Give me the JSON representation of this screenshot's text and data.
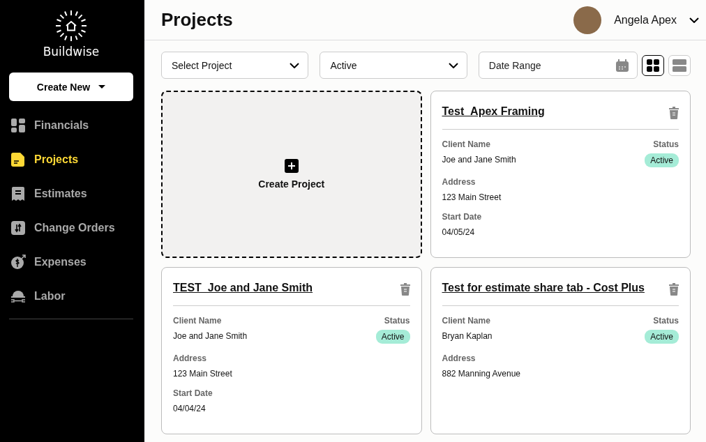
{
  "sidebar": {
    "brand": "Buildwise",
    "create_button": "Create New",
    "items": [
      {
        "label": "Financials",
        "kind": "grid",
        "selected": false
      },
      {
        "label": "Projects",
        "kind": "document",
        "selected": true
      },
      {
        "label": "Estimates",
        "kind": "receipt",
        "selected": false
      },
      {
        "label": "Change Orders",
        "kind": "swap",
        "selected": false
      },
      {
        "label": "Expenses",
        "kind": "coin",
        "selected": false
      },
      {
        "label": "Labor",
        "kind": "hardhat",
        "selected": false
      }
    ]
  },
  "header": {
    "title": "Projects",
    "user_name": "Angela Apex"
  },
  "filters": {
    "project_select": "Select Project",
    "status_select": "Active",
    "date_range": {
      "placeholder": "Date Range"
    },
    "view_modes": [
      {
        "kind": "grid",
        "selected": true
      },
      {
        "kind": "list",
        "selected": false
      }
    ]
  },
  "create_tile": {
    "label": "Create Project"
  },
  "projects": [
    {
      "name": "Test_Apex Framing",
      "status_label": "Status",
      "status": "Active",
      "fields": [
        {
          "label": "Client Name",
          "value": "Joe and Jane Smith"
        },
        {
          "label": "Address",
          "value": "123 Main Street"
        },
        {
          "label": "Start Date",
          "value": "04/05/24"
        }
      ]
    },
    {
      "name": "TEST_Joe and Jane Smith",
      "status_label": "Status",
      "status": "Active",
      "fields": [
        {
          "label": "Client Name",
          "value": "Joe and Jane Smith"
        },
        {
          "label": "Address",
          "value": "123 Main Street"
        },
        {
          "label": "Start Date",
          "value": "04/04/24"
        }
      ]
    },
    {
      "name": "Test for estimate share tab - Cost Plus",
      "status_label": "Status",
      "status": "Active",
      "fields": [
        {
          "label": "Client Name",
          "value": "Bryan Kaplan"
        },
        {
          "label": "Address",
          "value": "882 Manning Avenue"
        }
      ]
    }
  ]
}
